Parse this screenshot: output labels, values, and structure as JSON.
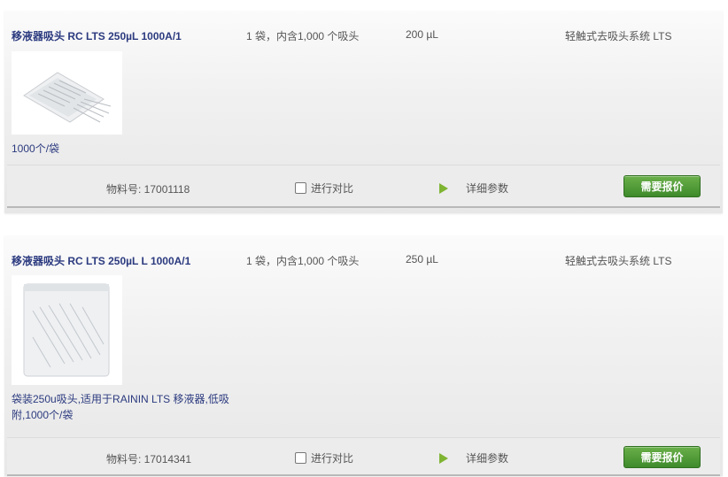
{
  "products": [
    {
      "name": "移液器吸头 RC LTS 250µL 1000A/1",
      "packaging": "1 袋，内含1,000 个吸头",
      "volume": "200 µL",
      "system": "轻触式去吸头系统 LTS",
      "image_icon": "tips-bag-image",
      "description": "1000个/袋",
      "part_number": "物料号: 17001118",
      "compare_label": "进行对比",
      "details_label": "详细参数",
      "quote_label": "需要报价"
    },
    {
      "name": "移液器吸头 RC LTS 250µL L 1000A/1",
      "packaging": "1 袋，内含1,000 个吸头",
      "volume": "250 µL",
      "system": "轻触式去吸头系统 LTS",
      "image_icon": "tips-bag-image",
      "description": "袋装250u吸头,适用于RAININ LTS 移液器,低吸附,1000个/袋",
      "part_number": "物料号: 17014341",
      "compare_label": "进行对比",
      "details_label": "详细参数",
      "quote_label": "需要报价"
    }
  ],
  "colors": {
    "link": "#2b3a7f",
    "button": "#4e9a36",
    "play_icon": "#7fb432"
  }
}
